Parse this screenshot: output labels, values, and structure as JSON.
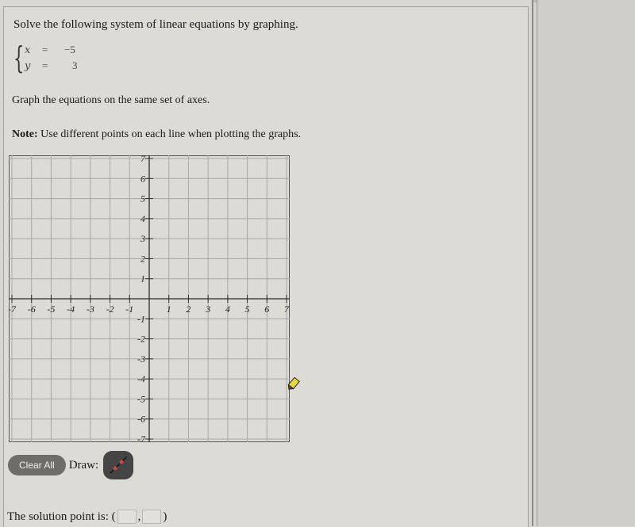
{
  "problem": {
    "prompt": "Solve the following system of linear equations by graphing.",
    "equations": [
      {
        "var": "x",
        "sign": "=",
        "value": "−5"
      },
      {
        "var": "y",
        "sign": "=",
        "value": "3"
      }
    ],
    "instruction": "Graph the equations on the same set of axes.",
    "note_label": "Note:",
    "note_text": " Use different points on each line when plotting the graphs."
  },
  "graph": {
    "x_range": [
      -7,
      7
    ],
    "y_range": [
      -7,
      7
    ],
    "x_ticks": [
      "-7",
      "-6",
      "-5",
      "-4",
      "-3",
      "-2",
      "-1",
      "1",
      "2",
      "3",
      "4",
      "5",
      "6",
      "7"
    ],
    "y_ticks": [
      "7",
      "6",
      "5",
      "4",
      "3",
      "2",
      "1",
      "-1",
      "-2",
      "-3",
      "-4",
      "-5",
      "-6",
      "-7"
    ],
    "colors": {
      "grid": "#a9a8a4",
      "axis": "#2a2a2a",
      "border": "#555555"
    }
  },
  "toolbar": {
    "clear_all_label": "Clear All",
    "draw_label": "Draw:",
    "draw_tool_icon": "line-tool-icon",
    "accent": "#c84a3f"
  },
  "solution": {
    "label": "The solution point is: (",
    "separator": ",",
    "close": ")",
    "x_value": "",
    "y_value": ""
  },
  "cursor": {
    "icon": "pencil-icon",
    "color": "#e8d840"
  }
}
